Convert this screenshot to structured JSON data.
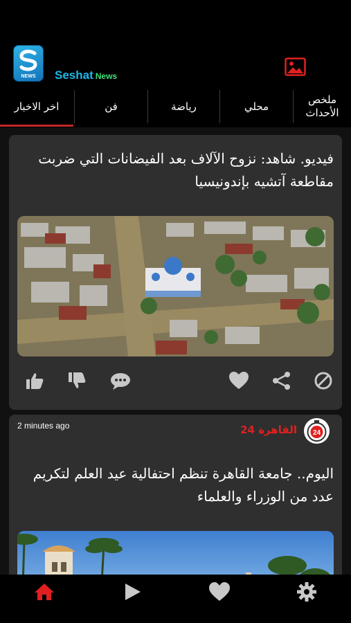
{
  "header": {
    "logo_caption": "NEWS",
    "brand_main": "Seshat",
    "brand_sub": "News",
    "gallery_icon": "image-gallery-icon"
  },
  "tabs": [
    {
      "label": "ملخص\nالأحداث"
    },
    {
      "label": "محلي"
    },
    {
      "label": "رياضة"
    },
    {
      "label": "فن"
    },
    {
      "label": "اخر الاخبار",
      "active": true
    }
  ],
  "cards": [
    {
      "title": "فيديو. شاهد: نزوح الآلاف بعد الفيضانات التي ضربت مقاطعة آتشيه بإندونيسيا",
      "actions": [
        "like-icon",
        "dislike-icon",
        "comment-icon",
        "favorite-icon",
        "share-icon",
        "block-icon"
      ]
    },
    {
      "timestamp": "2 minutes ago",
      "source": "القاهرة 24",
      "source_logo_text": "24",
      "title": "اليوم.. جامعة القاهرة تنظم احتفالية عيد العلم لتكريم عدد من الوزراء والعلماء"
    }
  ],
  "bottom_nav": [
    "home-icon",
    "play-icon",
    "heart-icon",
    "settings-icon"
  ],
  "colors": {
    "accent_red": "#e02020",
    "brand_blue": "#1fb7e8",
    "brand_green": "#3ee07a",
    "card_bg": "#2f2f2f",
    "icon_gray": "#c8c8c8"
  }
}
